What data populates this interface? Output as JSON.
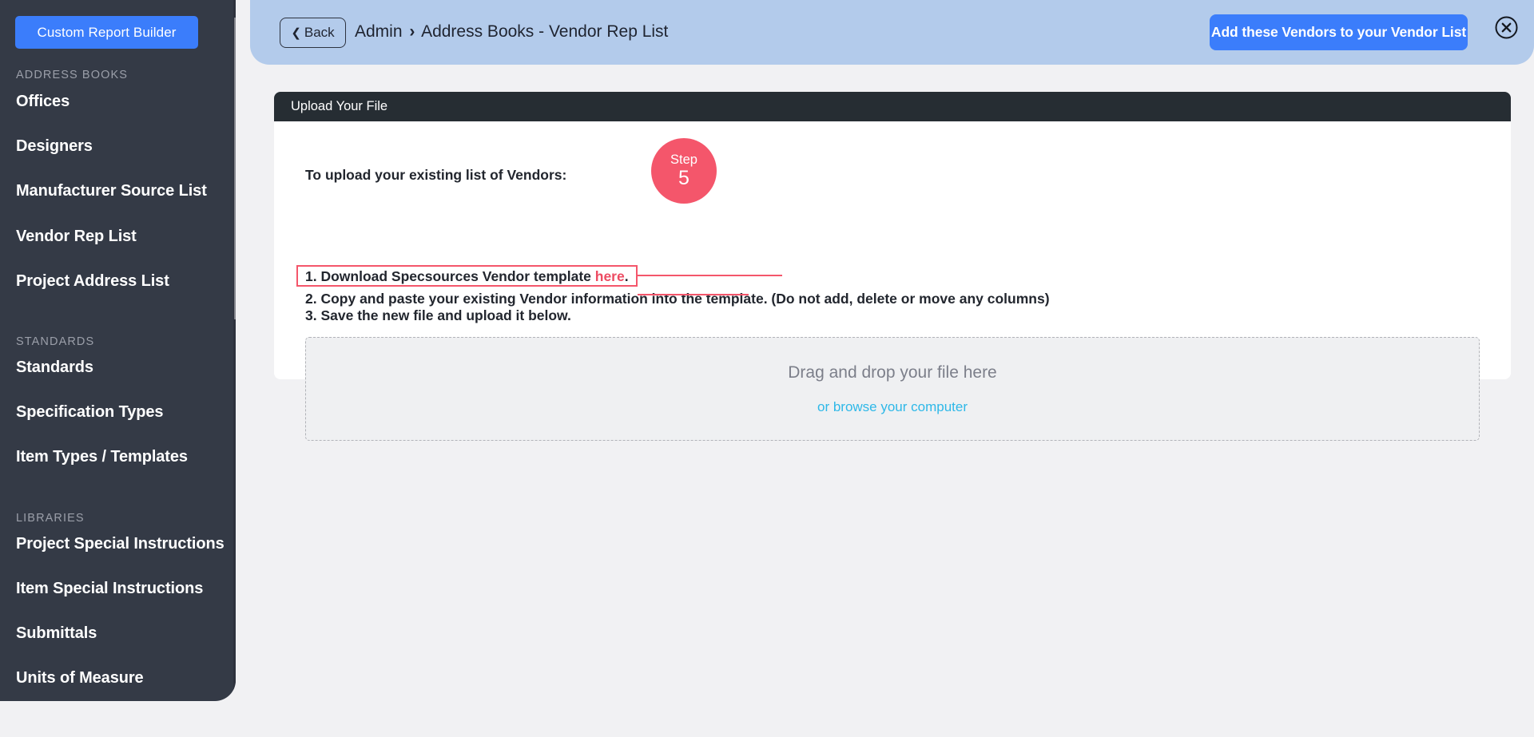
{
  "colors": {
    "accent_blue": "#3b7dfb",
    "header_bar": "#b3cbeb",
    "sidebar_bg": "#343a46",
    "card_header_bg": "#262d33",
    "step_badge": "#f4566b",
    "link_red": "#ed4b62",
    "link_cyan": "#2eb8e8",
    "page_bg": "#f1f1f3"
  },
  "sidebar": {
    "report_button": "Custom Report Builder",
    "sections": [
      {
        "label": "ADDRESS BOOKS",
        "items": [
          {
            "label": "Offices"
          },
          {
            "label": "Designers"
          },
          {
            "label": "Manufacturer Source List"
          },
          {
            "label": "Vendor Rep List"
          },
          {
            "label": "Project Address List"
          }
        ]
      },
      {
        "label": "STANDARDS",
        "items": [
          {
            "label": "Standards"
          },
          {
            "label": "Specification Types"
          },
          {
            "label": "Item Types / Templates"
          }
        ]
      },
      {
        "label": "LIBRARIES",
        "items": [
          {
            "label": "Project Special Instructions"
          },
          {
            "label": "Item Special Instructions"
          },
          {
            "label": "Submittals"
          },
          {
            "label": "Units of Measure"
          }
        ]
      }
    ],
    "scrollbar": {
      "up_arrow_icon": "chevron-up-icon",
      "down_arrow_icon": "chevron-down-icon"
    }
  },
  "header": {
    "back_button": {
      "label": "Back",
      "icon": "chevron-left-icon"
    },
    "breadcrumb": {
      "root": "Admin",
      "separator": "›",
      "current": "Address Books - Vendor Rep List"
    },
    "primary_button": "Add these Vendors to your Vendor List",
    "close_icon": "close-circle-icon"
  },
  "card": {
    "title": "Upload Your File",
    "instructions": {
      "intro": "To upload your existing list of Vendors:",
      "step1_prefix": "1. Download Specsources Vendor template ",
      "step1_link": "here",
      "step1_suffix": ".",
      "step2": "2. Copy and paste your existing Vendor information into the template. (Do not add, delete or move any columns)",
      "step3": "3. Save the new file and upload it below."
    },
    "step_badge": {
      "word": "Step",
      "number": "5"
    },
    "dropzone": {
      "main_text": "Drag and drop your file here",
      "browse_text": "or browse your computer"
    }
  }
}
